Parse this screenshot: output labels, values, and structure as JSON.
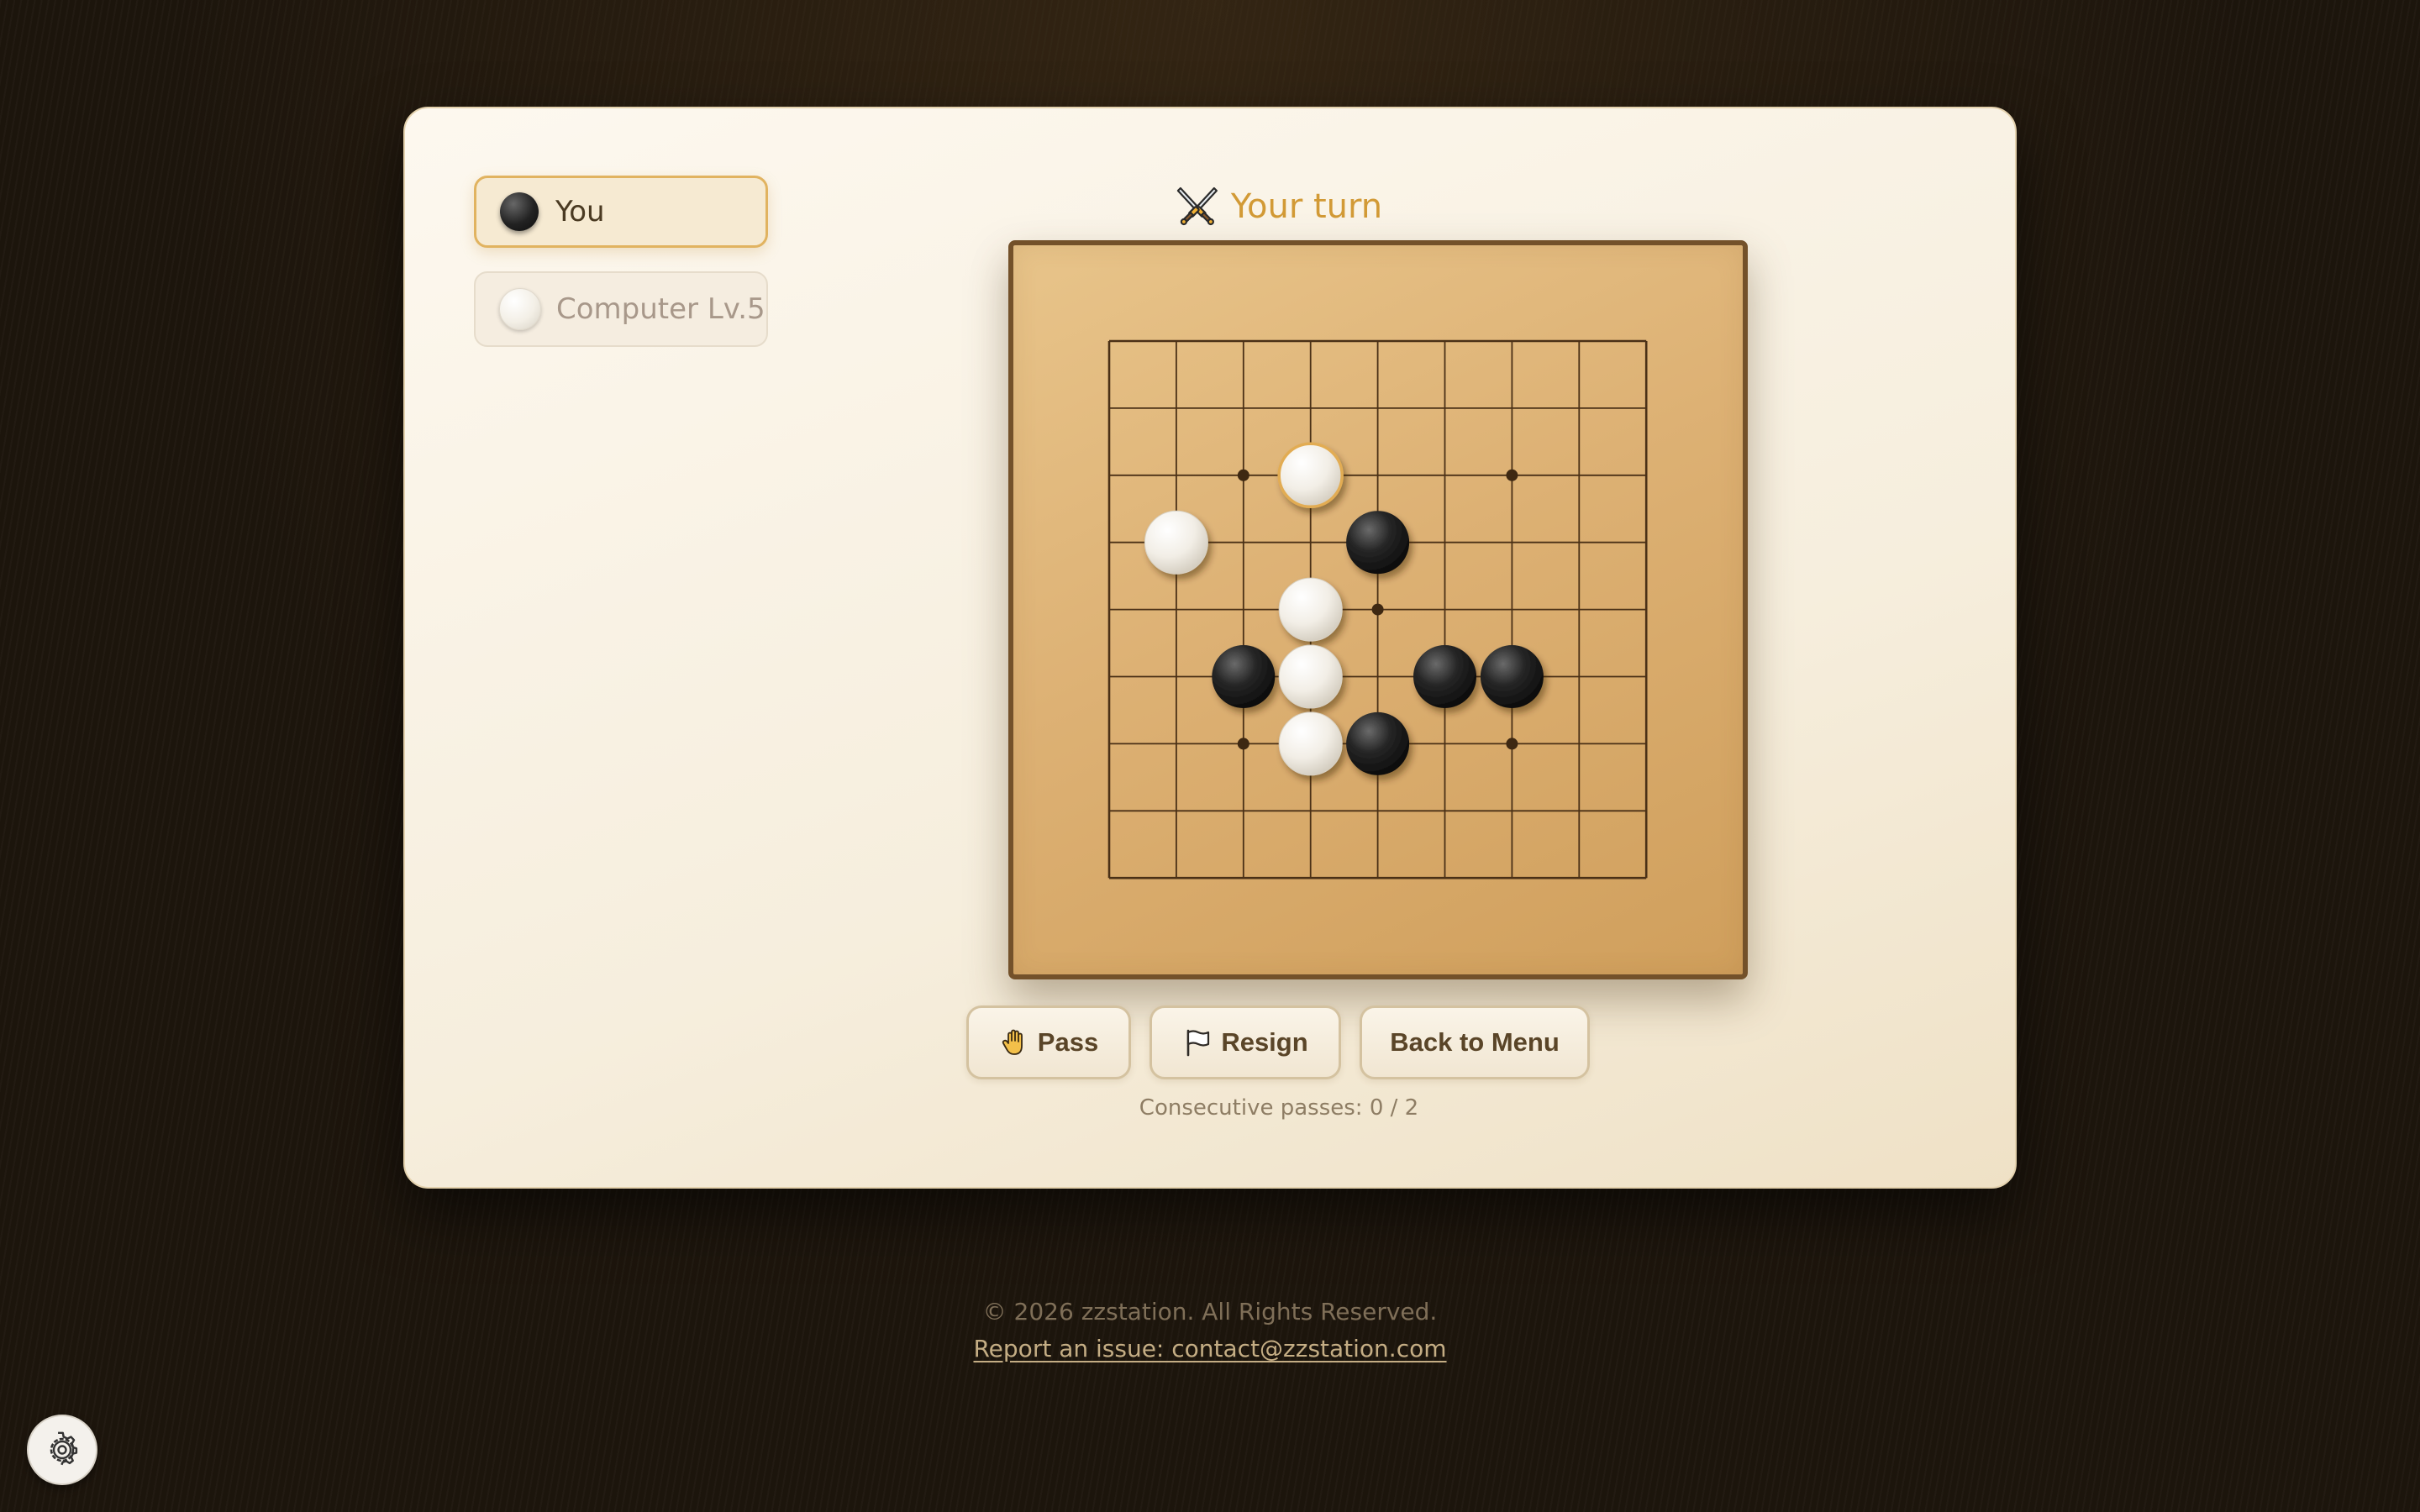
{
  "players": [
    {
      "label": "You",
      "stone": "black",
      "active": true
    },
    {
      "label": "Computer Lv.5",
      "stone": "white",
      "active": false
    }
  ],
  "status": {
    "turn_icon": "crossed-swords-icon",
    "turn_text": "Your turn",
    "turn_color": "#d29a36"
  },
  "board": {
    "size": 9,
    "star_points": [
      [
        2,
        2
      ],
      [
        6,
        2
      ],
      [
        4,
        4
      ],
      [
        2,
        6
      ],
      [
        6,
        6
      ]
    ],
    "stones": [
      {
        "col": 3,
        "row": 2,
        "color": "white",
        "last_move": true
      },
      {
        "col": 1,
        "row": 3,
        "color": "white"
      },
      {
        "col": 4,
        "row": 3,
        "color": "black"
      },
      {
        "col": 3,
        "row": 4,
        "color": "white"
      },
      {
        "col": 2,
        "row": 5,
        "color": "black"
      },
      {
        "col": 3,
        "row": 5,
        "color": "white"
      },
      {
        "col": 5,
        "row": 5,
        "color": "black"
      },
      {
        "col": 6,
        "row": 5,
        "color": "black"
      },
      {
        "col": 3,
        "row": 6,
        "color": "white"
      },
      {
        "col": 4,
        "row": 6,
        "color": "black"
      }
    ]
  },
  "actions": {
    "pass_icon": "hand-icon",
    "pass_label": "Pass",
    "resign_icon": "flag-icon",
    "resign_label": "Resign",
    "menu_label": "Back to Menu"
  },
  "passes_text": "Consecutive passes: 0 / 2",
  "footer": {
    "copyright": "© 2026 zzstation. All Rights Reserved.",
    "report": "Report an issue: contact@zzstation.com"
  },
  "settings_icon": "gear-icon"
}
